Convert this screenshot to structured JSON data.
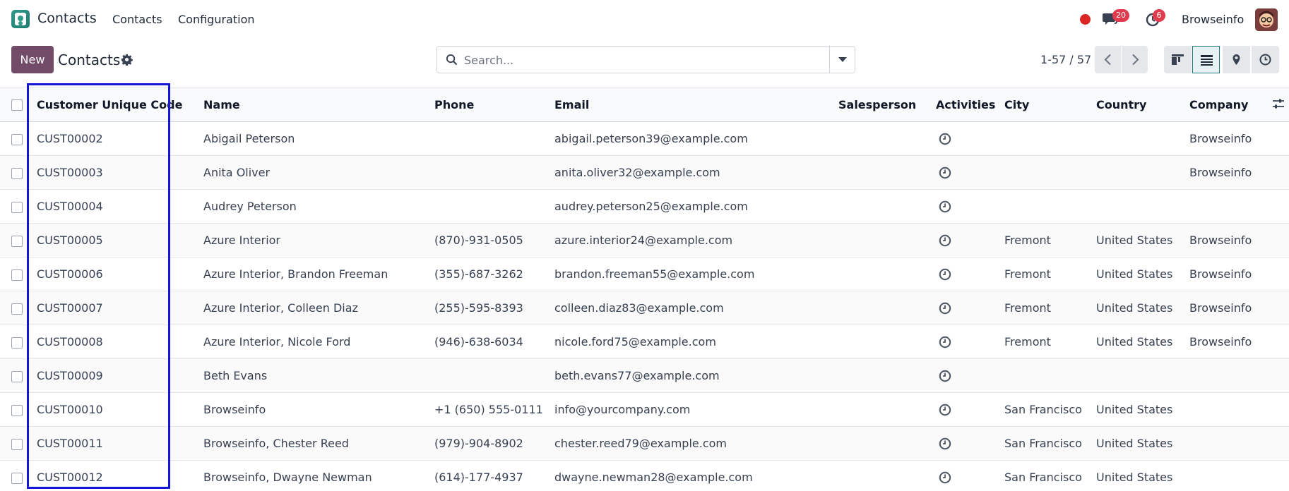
{
  "navbar": {
    "app_name": "Contacts",
    "menu": [
      "Contacts",
      "Configuration"
    ],
    "messages_count": "20",
    "activities_count": "6",
    "company": "Browseinfo"
  },
  "control_panel": {
    "new_label": "New",
    "title": "Contacts",
    "search_placeholder": "Search...",
    "pager": "1-57 / 57"
  },
  "table": {
    "columns": [
      "Customer Unique Code",
      "Name",
      "Phone",
      "Email",
      "Salesperson",
      "Activities",
      "City",
      "Country",
      "Company"
    ],
    "rows": [
      {
        "code": "CUST00002",
        "name": "Abigail Peterson",
        "phone": "",
        "email": "abigail.peterson39@example.com",
        "salesperson": "",
        "city": "",
        "country": "",
        "company": "Browseinfo"
      },
      {
        "code": "CUST00003",
        "name": "Anita Oliver",
        "phone": "",
        "email": "anita.oliver32@example.com",
        "salesperson": "",
        "city": "",
        "country": "",
        "company": "Browseinfo"
      },
      {
        "code": "CUST00004",
        "name": "Audrey Peterson",
        "phone": "",
        "email": "audrey.peterson25@example.com",
        "salesperson": "",
        "city": "",
        "country": "",
        "company": ""
      },
      {
        "code": "CUST00005",
        "name": "Azure Interior",
        "phone": "(870)-931-0505",
        "email": "azure.interior24@example.com",
        "salesperson": "",
        "city": "Fremont",
        "country": "United States",
        "company": "Browseinfo"
      },
      {
        "code": "CUST00006",
        "name": "Azure Interior, Brandon Freeman",
        "phone": "(355)-687-3262",
        "email": "brandon.freeman55@example.com",
        "salesperson": "",
        "city": "Fremont",
        "country": "United States",
        "company": "Browseinfo"
      },
      {
        "code": "CUST00007",
        "name": "Azure Interior, Colleen Diaz",
        "phone": "(255)-595-8393",
        "email": "colleen.diaz83@example.com",
        "salesperson": "",
        "city": "Fremont",
        "country": "United States",
        "company": "Browseinfo"
      },
      {
        "code": "CUST00008",
        "name": "Azure Interior, Nicole Ford",
        "phone": "(946)-638-6034",
        "email": "nicole.ford75@example.com",
        "salesperson": "",
        "city": "Fremont",
        "country": "United States",
        "company": "Browseinfo"
      },
      {
        "code": "CUST00009",
        "name": "Beth Evans",
        "phone": "",
        "email": "beth.evans77@example.com",
        "salesperson": "",
        "city": "",
        "country": "",
        "company": ""
      },
      {
        "code": "CUST00010",
        "name": "Browseinfo",
        "phone": "+1 (650) 555-0111",
        "email": "info@yourcompany.com",
        "salesperson": "",
        "city": "San Francisco",
        "country": "United States",
        "company": ""
      },
      {
        "code": "CUST00011",
        "name": "Browseinfo, Chester Reed",
        "phone": "(979)-904-8902",
        "email": "chester.reed79@example.com",
        "salesperson": "",
        "city": "San Francisco",
        "country": "United States",
        "company": ""
      },
      {
        "code": "CUST00012",
        "name": "Browseinfo, Dwayne Newman",
        "phone": "(614)-177-4937",
        "email": "dwayne.newman28@example.com",
        "salesperson": "",
        "city": "San Francisco",
        "country": "United States",
        "company": ""
      }
    ]
  },
  "colors": {
    "brand": "#714b67",
    "badge": "#e03b4e",
    "highlight": "#1515d6"
  }
}
